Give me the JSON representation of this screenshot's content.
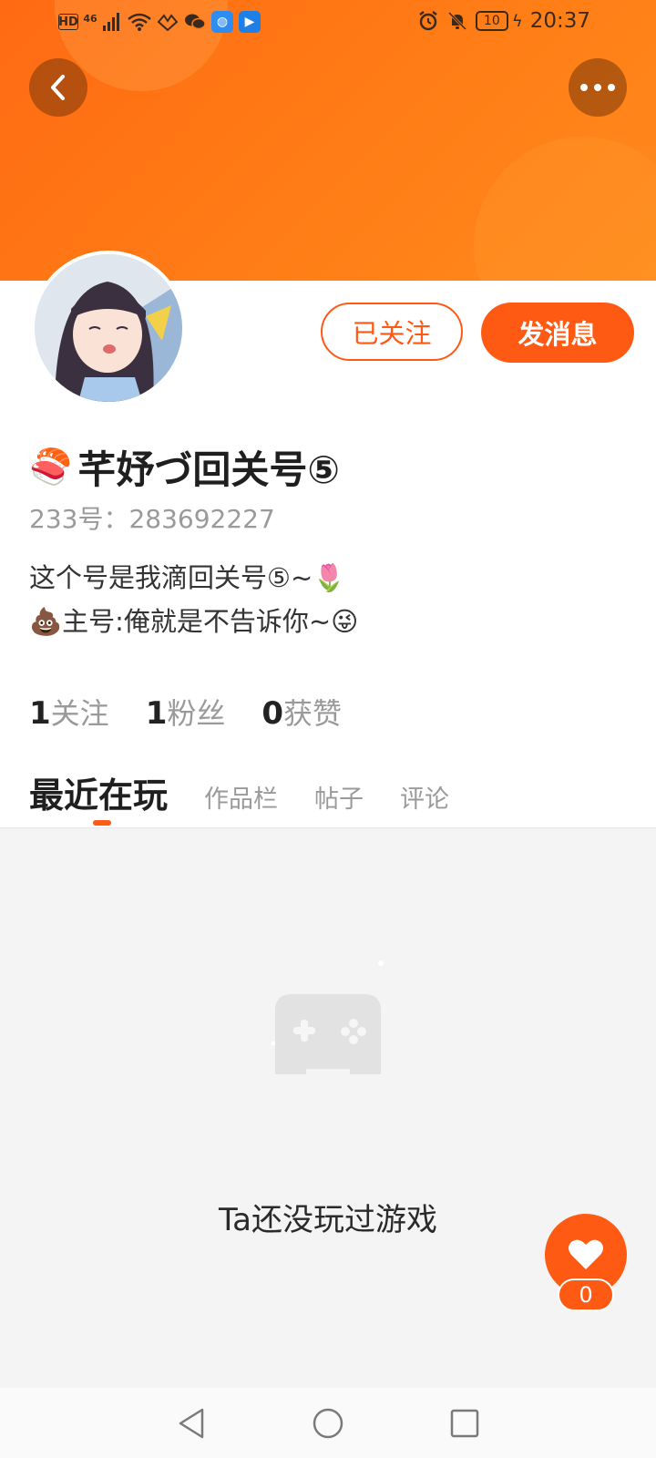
{
  "status_bar": {
    "hd_label": "HD",
    "network_label": "46",
    "battery": "10",
    "time": "20:37"
  },
  "header": {
    "back_icon": "chevron-left-icon",
    "more_icon": "more-horizontal-icon",
    "accent_color": "#ff6a13"
  },
  "profile": {
    "username": "芊妤づ回关号⑤",
    "username_emoji": "🍣",
    "user_id": "233号：283692227",
    "bio_lines": [
      "这个号是我滴回关号⑤~🌷",
      "💩主号:俺就是不告诉你~😜"
    ],
    "followed_label": "已关注",
    "message_label": "发消息"
  },
  "stats": [
    {
      "value": "1",
      "label": "关注"
    },
    {
      "value": "1",
      "label": "粉丝"
    },
    {
      "value": "0",
      "label": "获赞"
    }
  ],
  "tabs": [
    {
      "label": "最近在玩",
      "active": true
    },
    {
      "label": "作品栏",
      "active": false
    },
    {
      "label": "帖子",
      "active": false
    },
    {
      "label": "评论",
      "active": false
    }
  ],
  "empty_state": {
    "icon": "gamepad-icon",
    "text": "Ta还没玩过游戏"
  },
  "like": {
    "icon": "heart-icon",
    "count": "0"
  },
  "nav": {
    "back_icon": "nav-back-icon",
    "home_icon": "nav-home-icon",
    "recents_icon": "nav-recents-icon"
  }
}
